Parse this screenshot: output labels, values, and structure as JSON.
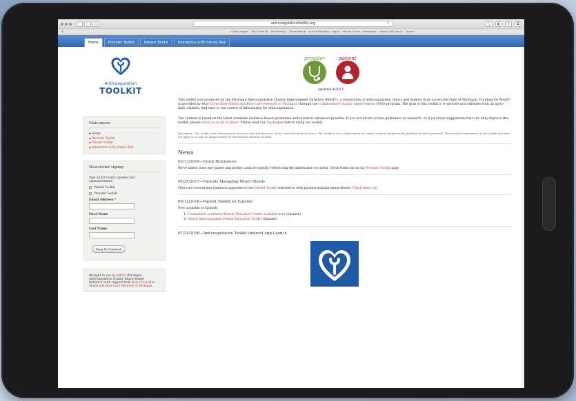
{
  "browser": {
    "url": "anticoagulationtoolkit.org",
    "bookmarks": [
      "Getty Images",
      "Blue Cross Bl... File Sharing",
      "Timesheets ▾",
      "Drive ReDesktop - Logon",
      "Market Comm...hotography",
      "Impact 360 Log In",
      "Fave ▾"
    ]
  },
  "tabs": [
    "Home",
    "Provider Toolkit",
    "Patient Toolkit",
    "Interactive A-fib Stroke Risk"
  ],
  "logo": {
    "sub": "Anticoagulation",
    "main": "TOOLKIT"
  },
  "menu": {
    "title": "Main menu",
    "items": [
      "Home",
      "Provider Toolkit",
      "Patient Toolkit",
      "Interactive A-fib Stroke Risk"
    ]
  },
  "newsletter": {
    "title": "Newsletter signup",
    "intro": "Sign up for toolkit updates and announcements.",
    "option1": "Patient Toolkit",
    "option2": "Provider Toolkit",
    "email_label": "Email Address *",
    "first_label": "First Name",
    "last_label": "Last Name",
    "button": "Keep Me Updated"
  },
  "support": {
    "prefix": "Brought to you by ",
    "maqi": "MAQI²",
    "middle": " (Michigan Anticoagulation Quality Improvement Initiative) with support from ",
    "bcbs": "Blue Cross Blue Shield and Blue Care Network of Michigan",
    "suffix": "."
  },
  "hero": {
    "provider": "provider",
    "patient": "patient",
    "updated": "(updated 4/2017)"
  },
  "intro": {
    "p1a": "This toolkit was produced by the Michigan Anticoagulation Quality Improvement Initiative (MAQI²), a consortium of anticoagulation clinics and experts from across the state of Michigan. Funding for MAQI² is provided by ",
    "p1link": "Blue Cross Blue Shield and Blue Care Network of Michigan",
    "p1b": " through the ",
    "p1link2": "Collaborative Quality Improvement",
    "p1c": " (CQI) program. The goal of this toolkit is to provide practitioners with an up-to-date, reliable, and easy to use source of information for anticoagulation.",
    "p2a": "The content is based on the latest available evidence-based guidelines and research whenever possible. If you are aware of new guidelines or research, or if you have suggestions that can help improve this toolkit, please ",
    "p2link": "email us to let us know",
    "p2b": ". Please read our ",
    "p2link2": "disclaimer",
    "p2c": " before using our toolkit.",
    "disclaimer": "Disclaimer: This toolkit is for informational purposes only and does not, itself, constitute medical advice. The toolkit is not a replacement for careful medical judgments by qualified medical personnel. There may be information in the toolkit that does not apply to or may be inappropriate for the medical situation at hand."
  },
  "news": {
    "heading": "News",
    "items": [
      {
        "title": "03/13/2018—Quick References",
        "body": "We've added some one-pagers and pocket cards for quickly referencing the information you need. Check them out on our ",
        "link": "Provider Toolkit",
        "tail": " page."
      },
      {
        "title": "08/29/2017—Patients Managing Minor Bleeds",
        "body": "There are several new handouts appended to the ",
        "link": "Patient Toolkit",
        "tail": " intended to help patients manage minor bleeds. ",
        "link2": "Check them out!"
      },
      {
        "title": "09/12/2016—Patient Toolkit en Español",
        "body": "Now available in Spanish:",
        "list": [
          "Coumadin® (warfarin) Patient Education Toolkit available here",
          "Newer Anticoagulants Patient Education Toolkit"
        ],
        "list_tail": " (Spanish)"
      },
      {
        "title": "07/22/2016—Anticoagulation Toolkit Android App Launch"
      }
    ]
  },
  "colors": {
    "brand_blue": "#1f5aa8",
    "link_red": "#b23a2a",
    "provider_green": "#6f9a3a",
    "patient_red": "#b2232e"
  }
}
